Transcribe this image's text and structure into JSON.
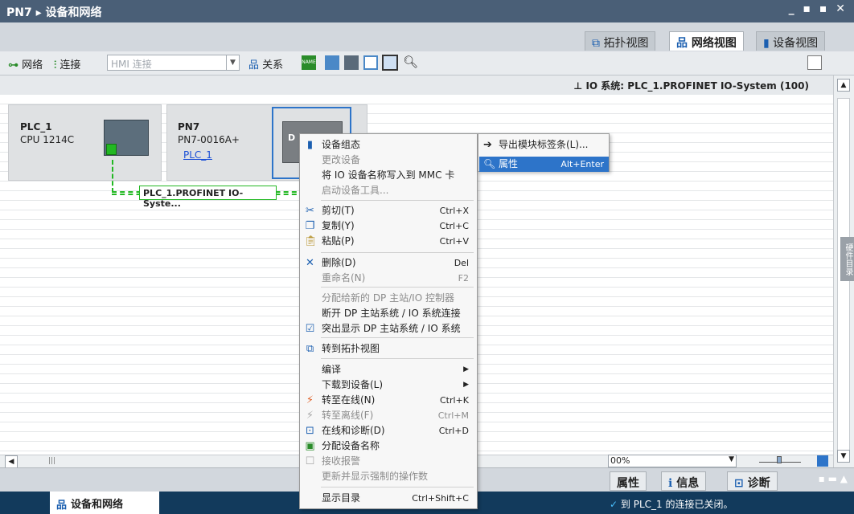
{
  "window": {
    "title": "PN7 ▸ 设备和网络",
    "controls": "_ ▪ ▪ ✕"
  },
  "view_tabs": [
    "拓扑视图",
    "网络视图",
    "设备视图"
  ],
  "toolbar": {
    "network": "网络",
    "connections": "连接",
    "hmi_select": "HMI 连接",
    "relations": "关系",
    "name_icon_text": "NAME"
  },
  "io_system_bar": {
    "label": "IO 系统:",
    "value": "PLC_1.PROFINET IO-System (100)"
  },
  "devices": {
    "plc": {
      "name": "PLC_1",
      "type": "CPU 1214C"
    },
    "pn7": {
      "name": "PN7",
      "type": "PN7-0016A+",
      "link": "PLC_1",
      "partial_label": "D"
    }
  },
  "network_label": "PLC_1.PROFINET IO-Syste...",
  "zoom": "00%",
  "inspector_tabs": [
    "属性",
    "信息",
    "诊断"
  ],
  "status": {
    "task_button": "设备和网络",
    "message": "到 PLC_1 的连接已关闭。"
  },
  "sidebar_tab": "硬件目录",
  "context_menu": {
    "items": [
      {
        "label": "设备组态",
        "shortcut": "",
        "disabled": false,
        "icon": "device-config"
      },
      {
        "label": "更改设备",
        "shortcut": "",
        "disabled": true,
        "icon": ""
      },
      {
        "label": "将 IO 设备名称写入到 MMC 卡",
        "shortcut": "",
        "disabled": false,
        "icon": ""
      },
      {
        "label": "启动设备工具...",
        "shortcut": "",
        "disabled": true,
        "icon": ""
      },
      {
        "label": "剪切(T)",
        "shortcut": "Ctrl+X",
        "disabled": false,
        "icon": "cut"
      },
      {
        "label": "复制(Y)",
        "shortcut": "Ctrl+C",
        "disabled": false,
        "icon": "copy"
      },
      {
        "label": "粘贴(P)",
        "shortcut": "Ctrl+V",
        "disabled": false,
        "icon": "paste"
      },
      {
        "label": "删除(D)",
        "shortcut": "Del",
        "disabled": false,
        "icon": "delete"
      },
      {
        "label": "重命名(N)",
        "shortcut": "F2",
        "disabled": true,
        "icon": ""
      },
      {
        "label": "分配给新的 DP 主站/IO 控制器",
        "shortcut": "",
        "disabled": true,
        "icon": ""
      },
      {
        "label": "断开 DP 主站系统 / IO 系统连接",
        "shortcut": "",
        "disabled": false,
        "icon": ""
      },
      {
        "label": "突出显示 DP 主站系统 / IO 系统",
        "shortcut": "",
        "disabled": false,
        "icon": "checkbox"
      },
      {
        "label": "转到拓扑视图",
        "shortcut": "",
        "disabled": false,
        "icon": "topology"
      },
      {
        "label": "编译",
        "shortcut": "",
        "disabled": false,
        "icon": "",
        "submenu": true
      },
      {
        "label": "下载到设备(L)",
        "shortcut": "",
        "disabled": false,
        "icon": "",
        "submenu": true
      },
      {
        "label": "转至在线(N)",
        "shortcut": "Ctrl+K",
        "disabled": false,
        "icon": "go-online"
      },
      {
        "label": "转至离线(F)",
        "shortcut": "Ctrl+M",
        "disabled": true,
        "icon": "go-offline"
      },
      {
        "label": "在线和诊断(D)",
        "shortcut": "Ctrl+D",
        "disabled": false,
        "icon": "diagnostics"
      },
      {
        "label": "分配设备名称",
        "shortcut": "",
        "disabled": false,
        "icon": "assign-name"
      },
      {
        "label": "接收报警",
        "shortcut": "",
        "disabled": true,
        "icon": "alarm"
      },
      {
        "label": "更新并显示强制的操作数",
        "shortcut": "",
        "disabled": true,
        "icon": ""
      },
      {
        "label": "显示目录",
        "shortcut": "Ctrl+Shift+C",
        "disabled": false,
        "icon": ""
      }
    ]
  },
  "sub_menu": {
    "items": [
      {
        "label": "导出模块标签条(L)...",
        "shortcut": ""
      },
      {
        "label": "属性",
        "shortcut": "Alt+Enter"
      }
    ]
  }
}
